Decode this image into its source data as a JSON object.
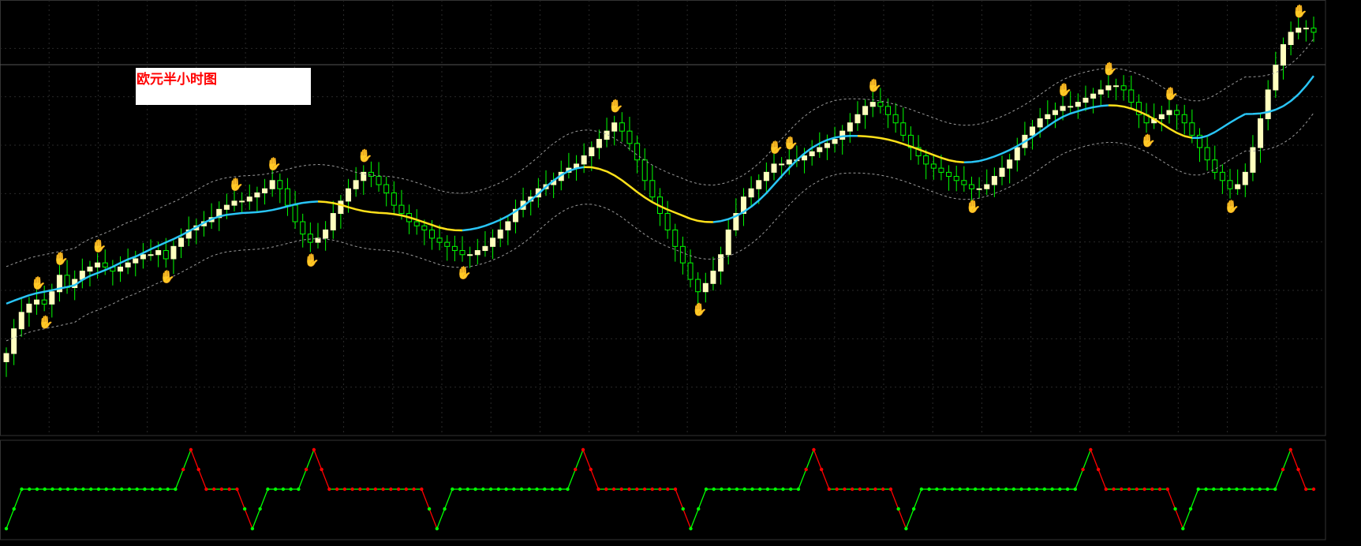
{
  "window": {
    "header": "",
    "ind_header": ""
  },
  "annotation": {
    "text": "欧元半小时图"
  },
  "colors": {
    "background": "#000000",
    "bull_candle": "#ffffbf",
    "bear_candle": "#00ff00",
    "wick": "#00ff00",
    "ma_up": "#29c5f6",
    "ma_down": "#ffe11a",
    "band": "#9a9a9a",
    "grid": "#2a2a2a",
    "sig_up": "#00ff00",
    "sig_down": "#ff0000",
    "hand_top": "#ff0000",
    "hand_bottom": "#1e90ff"
  },
  "chart_data": [
    {
      "type": "candlestick",
      "instrument": "EURUSD",
      "timeframe": "M30",
      "ylim": [
        0,
        100
      ],
      "closes": [
        18,
        24,
        28,
        30,
        31,
        30,
        33,
        37,
        34,
        36,
        38,
        39,
        40,
        39,
        38,
        39,
        40,
        41,
        42,
        42,
        43,
        41,
        44,
        46,
        48,
        49,
        50,
        51,
        53,
        54,
        55,
        55,
        56,
        57,
        58,
        60,
        58,
        54,
        50,
        47,
        45,
        46,
        48,
        52,
        55,
        58,
        60,
        62,
        61,
        59,
        57,
        54,
        52,
        50,
        49,
        48,
        46,
        45,
        44,
        43,
        42,
        42,
        43,
        44,
        46,
        48,
        50,
        53,
        55,
        56,
        58,
        59,
        60,
        62,
        63,
        64,
        66,
        68,
        70,
        72,
        74,
        72,
        69,
        65,
        60,
        56,
        52,
        48,
        44,
        40,
        36,
        33,
        35,
        38,
        42,
        48,
        52,
        56,
        58,
        60,
        62,
        64,
        64,
        65,
        65,
        66,
        67,
        68,
        69,
        70,
        72,
        74,
        76,
        78,
        79,
        78,
        76,
        74,
        71,
        68,
        66,
        64,
        63,
        62,
        61,
        60,
        59,
        58,
        58,
        59,
        61,
        63,
        65,
        68,
        71,
        73,
        75,
        76,
        77,
        78,
        78,
        79,
        80,
        81,
        82,
        83,
        83,
        82,
        79,
        76,
        74,
        75,
        76,
        77,
        76,
        74,
        71,
        68,
        65,
        62,
        60,
        58,
        59,
        62,
        68,
        75,
        82,
        88,
        93,
        96,
        97,
        97,
        96
      ]
    },
    {
      "type": "line",
      "name": "",
      "ylim": [
        -100,
        100
      ],
      "y_ticks": [],
      "values": [
        -100,
        -50,
        0,
        0,
        0,
        0,
        0,
        0,
        0,
        0,
        0,
        0,
        0,
        0,
        0,
        0,
        0,
        0,
        0,
        0,
        0,
        0,
        0,
        50,
        100,
        50,
        0,
        0,
        0,
        0,
        0,
        -50,
        -100,
        -50,
        0,
        0,
        0,
        0,
        0,
        50,
        100,
        50,
        0,
        0,
        0,
        0,
        0,
        0,
        0,
        0,
        0,
        0,
        0,
        0,
        0,
        -50,
        -100,
        -50,
        0,
        0,
        0,
        0,
        0,
        0,
        0,
        0,
        0,
        0,
        0,
        0,
        0,
        0,
        0,
        0,
        50,
        100,
        50,
        0,
        0,
        0,
        0,
        0,
        0,
        0,
        0,
        0,
        0,
        0,
        -50,
        -100,
        -50,
        0,
        0,
        0,
        0,
        0,
        0,
        0,
        0,
        0,
        0,
        0,
        0,
        0,
        50,
        100,
        50,
        0,
        0,
        0,
        0,
        0,
        0,
        0,
        0,
        0,
        -50,
        -100,
        -50,
        0,
        0,
        0,
        0,
        0,
        0,
        0,
        0,
        0,
        0,
        0,
        0,
        0,
        0,
        0,
        0,
        0,
        0,
        0,
        0,
        0,
        50,
        100,
        50,
        0,
        0,
        0,
        0,
        0,
        0,
        0,
        0,
        0,
        -50,
        -100,
        -50,
        0,
        0,
        0,
        0,
        0,
        0,
        0,
        0,
        0,
        0,
        0,
        50,
        100,
        50,
        0,
        0
      ]
    }
  ]
}
